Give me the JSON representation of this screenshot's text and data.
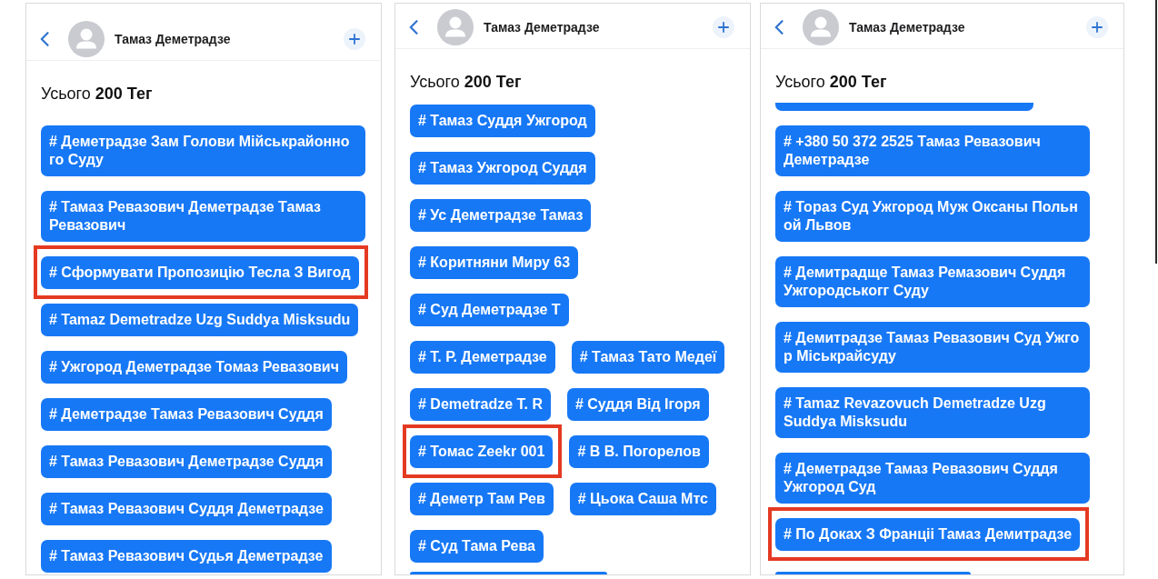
{
  "panels": [
    {
      "header": {
        "name": "Тамаз Деметрадзе"
      },
      "total": "Усього **200 Тег**",
      "clipped_top": false,
      "clipped_bottom": false,
      "tags": [
        {
          "label": "# Деметрадзе Зам Голови Мійськрайонно го Суду",
          "highlighted": false
        },
        {
          "label": "# Тамаз Ревазович Деметрадзе Тамаз Ревазович",
          "highlighted": false
        },
        {
          "label": "# Сформувати Пропозицію Тесла З Вигод",
          "highlighted": true
        },
        {
          "label": "# Tamaz Demetradze Uzg Suddya Misksudu",
          "highlighted": false
        },
        {
          "label": "# Ужгород Деметрадзе Томаз Ревазович",
          "highlighted": false
        },
        {
          "label": "# Деметрадзе Тамаз Ревазович Суддя",
          "highlighted": false
        },
        {
          "label": "# Тамаз Ревазович Деметрадзе Суддя",
          "highlighted": false
        },
        {
          "label": "# Тамаз Ревазович Суддя Деметрадзе",
          "highlighted": false
        },
        {
          "label": "# Тамаз Ревазович Судья Деметрадзе",
          "highlighted": false
        }
      ]
    },
    {
      "header": {
        "name": "Тамаз Деметрадзе"
      },
      "total": "Усього **200 Тег**",
      "clipped_top": false,
      "clipped_bottom": true,
      "tags": [
        {
          "label": "# Тамаз Суддя Ужгород",
          "highlighted": false
        },
        {
          "label": "# Тамаз Ужгород Суддя",
          "highlighted": false
        },
        {
          "label": "# Ус Деметрадзе Тамаз",
          "highlighted": false
        },
        {
          "label": "# Коритняни Миру 63",
          "highlighted": false
        },
        {
          "label": "# Суд Деметрадзе Т",
          "highlighted": false
        },
        {
          "label": "# Т. Р. Деметрадзе",
          "highlighted": false
        },
        {
          "label": "# Тамаз Тато Медеї",
          "highlighted": false
        },
        {
          "label": "# Demetradze T. R",
          "highlighted": false
        },
        {
          "label": "# Суддя Від Ігоря",
          "highlighted": false
        },
        {
          "label": "# Томас Zeekr 001",
          "highlighted": true
        },
        {
          "label": "# В В. Погорелов",
          "highlighted": false
        },
        {
          "label": "# Деметр Там Рев",
          "highlighted": false
        },
        {
          "label": "# Цьока Саша Мтс",
          "highlighted": false
        },
        {
          "label": "# Суд Тама Рева",
          "highlighted": false
        }
      ]
    },
    {
      "header": {
        "name": "Тамаз Деметрадзе"
      },
      "total": "Усього **200 Тег**",
      "clipped_top": true,
      "clipped_bottom": true,
      "tags": [
        {
          "label": "# +380 50 372 2525 Тамаз Ревазович Деметрадзе",
          "highlighted": false
        },
        {
          "label": "# Тораз Суд Ужгород Муж Оксаны Польн ой Львов",
          "highlighted": false
        },
        {
          "label": "# Демитрадще Тамаз Ремазович Суддя Ужгородськогг Суду",
          "highlighted": false
        },
        {
          "label": "# Демитрадзе Тамаз Ревазович Суд Ужго р Міськрайсуду",
          "highlighted": false
        },
        {
          "label": "# Tamaz Revazovuch Demetradze Uzg Suddya Misksudu",
          "highlighted": false
        },
        {
          "label": "# Деметрадзе Тамаз Ревазович Суддя Ужгород Суд",
          "highlighted": false
        },
        {
          "label": "# По Доках З Франціі Тамаз Демитрадзе",
          "highlighted": true
        }
      ]
    }
  ]
}
